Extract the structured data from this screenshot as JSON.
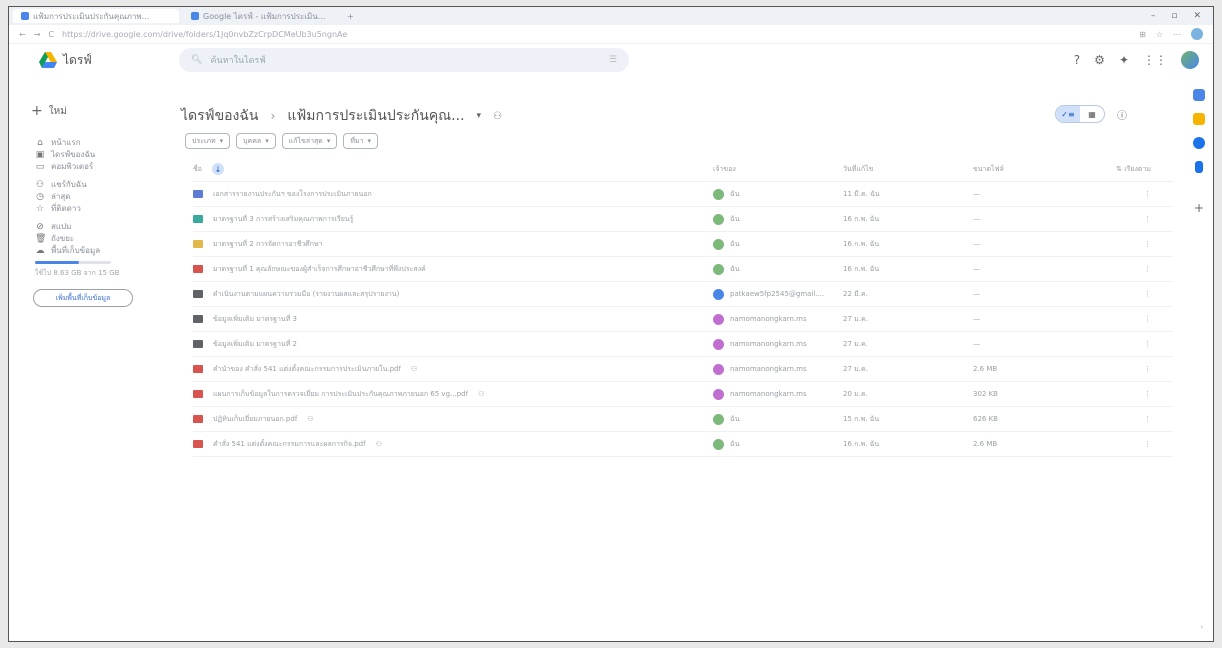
{
  "browser": {
    "tab1": "แฟ้มการประเมินประกันคุณภาพ...",
    "tab2": "Google ไดรฟ์ - แฟ้มการประเมิน...",
    "url": "https://drive.google.com/drive/folders/1Jq0nvbZzCrpDCMeUb3u5ngnAe"
  },
  "header": {
    "app_name": "ไดรฟ์",
    "search_placeholder": "ค้นหาในไดรฟ์"
  },
  "sidebar": {
    "new_label": "ใหม่",
    "items": [
      {
        "label": "หน้าแรก",
        "icon": "home-icon",
        "glyph": "⌂"
      },
      {
        "label": "ไดรฟ์ของฉัน",
        "icon": "my-drive-icon",
        "glyph": "▣"
      },
      {
        "label": "คอมพิวเตอร์",
        "icon": "computer-icon",
        "glyph": "▭"
      },
      {
        "label": "แชร์กับฉัน",
        "icon": "shared-icon",
        "glyph": "⚇"
      },
      {
        "label": "ล่าสุด",
        "icon": "clock-icon",
        "glyph": "◷"
      },
      {
        "label": "ที่ติดดาว",
        "icon": "star-icon",
        "glyph": "☆"
      },
      {
        "label": "สแปม",
        "icon": "spam-icon",
        "glyph": "⊘"
      },
      {
        "label": "ถังขยะ",
        "icon": "trash-icon",
        "glyph": "🗑"
      },
      {
        "label": "พื้นที่เก็บข้อมูล",
        "icon": "cloud-icon",
        "glyph": "☁"
      }
    ],
    "storage_text": "ใช้ไป 8.63 GB จาก 15 GB",
    "storage_fraction": 0.575,
    "buy_label": "เพิ่มพื้นที่เก็บข้อมูล"
  },
  "breadcrumb": {
    "root": "ไดรฟ์ของฉัน",
    "current": "แฟ้มการประเมินประกันคุณ..."
  },
  "filters": [
    "ประเภท",
    "บุคคล",
    "แก้ไขล่าสุด",
    "ที่มา"
  ],
  "columns": {
    "name": "ชื่อ",
    "owner": "เจ้าของ",
    "modified": "วันที่แก้ไข",
    "size": "ขนาดไฟล์",
    "sort": "เรียงตาม"
  },
  "rows": [
    {
      "name": "เอกสารรายงานประกันฯ ของโรงการประเมินภายนอก",
      "type": "folder",
      "color": "#5b7bd5",
      "owner": "ฉัน",
      "owner_color": "#7cb97a",
      "date": "11 มี.ค. ฉัน",
      "size": "—"
    },
    {
      "name": "มาตรฐานที่ 3 การสร้างเสริมคุณภาพการเรียนรู้",
      "type": "folder",
      "color": "#3aa99f",
      "owner": "ฉัน",
      "owner_color": "#7cb97a",
      "date": "16 ก.พ. ฉัน",
      "size": "—"
    },
    {
      "name": "มาตรฐานที่ 2 การจัดการอาชีวศึกษา",
      "type": "folder",
      "color": "#e2b84b",
      "owner": "ฉัน",
      "owner_color": "#7cb97a",
      "date": "16 ก.พ. ฉัน",
      "size": "—"
    },
    {
      "name": "มาตรฐานที่ 1 คุณลักษณะของผู้สำเร็จการศึกษาอาชีวศึกษาที่พึงประสงค์",
      "type": "folder",
      "color": "#d9534f",
      "owner": "ฉัน",
      "owner_color": "#7cb97a",
      "date": "16 ก.พ. ฉัน",
      "size": "—"
    },
    {
      "name": "ดำเนินงานตามแผนความร่วมมือ (รายงานผลและสรุปรายงาน)",
      "type": "folder",
      "color": "#5f6368",
      "owner": "patkaew5fp2545@gmail....",
      "owner_color": "#4a86e8",
      "date": "22 มี.ค.",
      "size": "—"
    },
    {
      "name": "ข้อมูลเพิ่มเติม มาตรฐานที่ 3",
      "type": "folder",
      "color": "#5f6368",
      "owner": "namomanongkarn.ms",
      "owner_color": "#c06fd0",
      "date": "27 ม.ค.",
      "size": "—"
    },
    {
      "name": "ข้อมูลเพิ่มเติม มาตรฐานที่ 2",
      "type": "folder",
      "color": "#5f6368",
      "owner": "namomanongkarn.ms",
      "owner_color": "#c06fd0",
      "date": "27 ม.ค.",
      "size": "—"
    },
    {
      "name": "คำนำของ คำสั่ง 541 แต่งตั้งคณะกรรมการประเมินภายใน.pdf",
      "type": "pdf",
      "color": "#d9534f",
      "owner": "namomanongkarn.ms",
      "owner_color": "#c06fd0",
      "date": "27 ม.ค.",
      "size": "2.6 MB",
      "shared": true
    },
    {
      "name": "แผนการเก็บข้อมูลในการตรวจเยี่ยม การประเมินประกันคุณภาพภายนอก 65 vg...pdf",
      "type": "pdf",
      "color": "#d9534f",
      "owner": "namomanongkarn.ms",
      "owner_color": "#c06fd0",
      "date": "20 ม.ค.",
      "size": "302 KB",
      "shared": true
    },
    {
      "name": "ปฏิทินเก็บเยี่ยมภายนอก.pdf",
      "type": "pdf",
      "color": "#d9534f",
      "owner": "ฉัน",
      "owner_color": "#7cb97a",
      "date": "15 ก.พ. ฉัน",
      "size": "626 KB",
      "shared": true
    },
    {
      "name": "คำสั่ง 541 แต่งตั้งคณะกรรมการและผลการกิจ.pdf",
      "type": "pdf",
      "color": "#d9534f",
      "owner": "ฉัน",
      "owner_color": "#7cb97a",
      "date": "16 ก.พ. ฉัน",
      "size": "2.6 MB",
      "shared": true
    }
  ]
}
